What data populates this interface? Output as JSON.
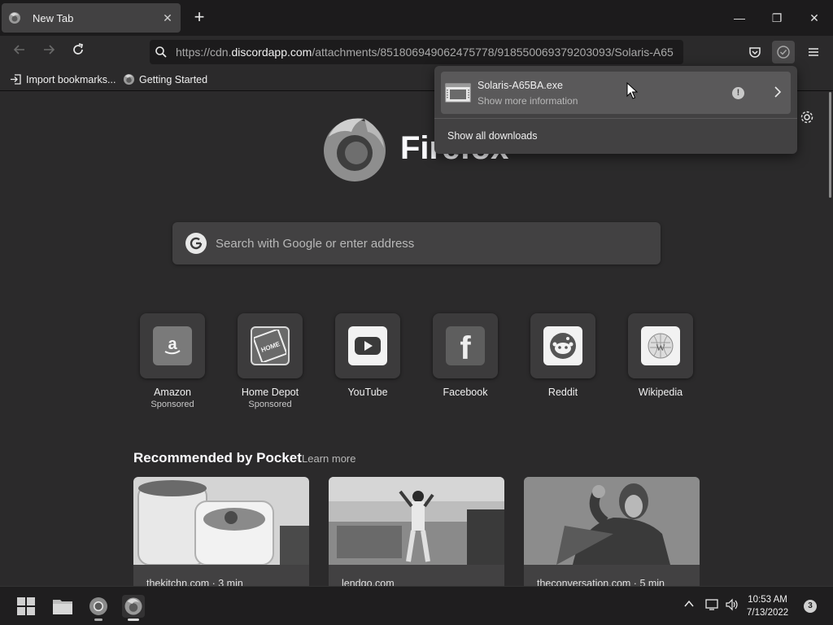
{
  "tab": {
    "title": "New Tab",
    "close": "✕"
  },
  "window_controls": {
    "minimize": "—",
    "restore": "❐",
    "close": "✕"
  },
  "newtab": "+",
  "urlbar": {
    "prefix": "https://cdn.",
    "host": "discordapp.com",
    "path": "/attachments/851806949062475778/918550069379203093/Solaris-A65"
  },
  "bookmarks": [
    {
      "label": "Import bookmarks..."
    },
    {
      "label": "Getting Started"
    }
  ],
  "newtab_page": {
    "wordmark": "Firefox",
    "search_placeholder": "Search with Google or enter address",
    "tiles": [
      {
        "name": "Amazon",
        "sponsored": "Sponsored",
        "icon": "amazon-icon"
      },
      {
        "name": "Home Depot",
        "sponsored": "Sponsored",
        "icon": "home-depot-icon"
      },
      {
        "name": "YouTube",
        "sponsored": "",
        "icon": "youtube-icon"
      },
      {
        "name": "Facebook",
        "sponsored": "",
        "icon": "facebook-icon"
      },
      {
        "name": "Reddit",
        "sponsored": "",
        "icon": "reddit-icon"
      },
      {
        "name": "Wikipedia",
        "sponsored": "",
        "icon": "wikipedia-icon"
      }
    ],
    "pocket": {
      "title": "Recommended by Pocket",
      "learn_more": "Learn more",
      "cards": [
        {
          "source": "thekitchn.com · 3 min"
        },
        {
          "source": "lendgo.com"
        },
        {
          "source": "theconversation.com · 5 min"
        }
      ]
    }
  },
  "downloads_panel": {
    "file_name": "Solaris-A65BA.exe",
    "status": "Show more information",
    "warning": "!",
    "show_all": "Show all downloads"
  },
  "taskbar": {
    "time": "10:53 AM",
    "date": "7/13/2022",
    "notifications": "3"
  }
}
